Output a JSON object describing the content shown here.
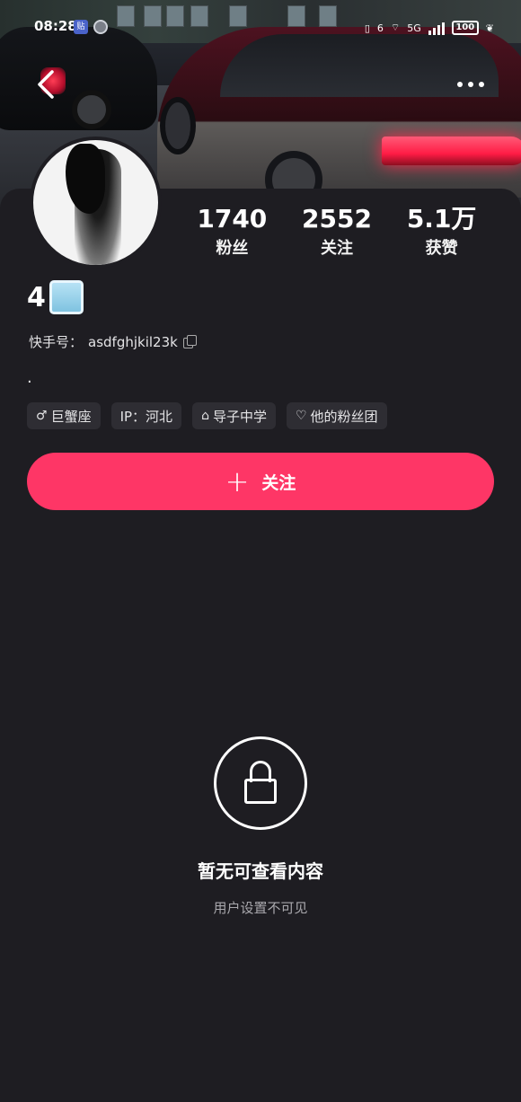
{
  "status_bar": {
    "time": "08:28",
    "notif_app_badge": "贴",
    "network": "5G",
    "sim": "6",
    "battery": "100"
  },
  "header": {
    "back_icon": "back-arrow-icon",
    "more_icon": "more-dots-icon"
  },
  "profile": {
    "stats": [
      {
        "value": "1740",
        "label": "粉丝"
      },
      {
        "value": "2552",
        "label": "关注"
      },
      {
        "value": "5.1万",
        "label": "获赞"
      }
    ],
    "username": "4",
    "kuaishou_id_label": "快手号：",
    "kuaishou_id": "asdfghjkil23k",
    "bio": ".",
    "tags": [
      {
        "icon": "male-icon",
        "glyph": "♂",
        "text": "巨蟹座"
      },
      {
        "icon": "",
        "glyph": "",
        "text": "IP：河北"
      },
      {
        "icon": "graduation-cap-icon",
        "glyph": "🎓",
        "text": "导子中学"
      },
      {
        "icon": "heart-icon",
        "glyph": "♡",
        "text": "他的粉丝团"
      }
    ],
    "follow_button": {
      "icon": "plus-icon",
      "plus": "+",
      "label": "关注"
    }
  },
  "empty_state": {
    "icon": "lock-icon",
    "title": "暂无可查看内容",
    "subtitle": "用户设置不可见"
  },
  "colors": {
    "background": "#1e1d22",
    "accent": "#fe3666",
    "tag_bg": "#2e2d33"
  }
}
